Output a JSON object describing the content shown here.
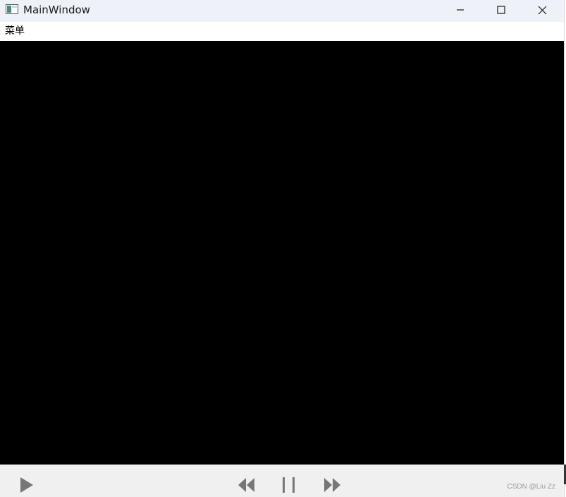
{
  "window": {
    "title": "MainWindow",
    "controls": {
      "minimize_icon": "minimize-icon",
      "maximize_icon": "maximize-icon",
      "close_icon": "close-icon"
    }
  },
  "menubar": {
    "items": [
      {
        "label": "菜单"
      }
    ]
  },
  "video": {
    "background": "#000000"
  },
  "playback_controls": {
    "play_icon": "play-icon",
    "rewind_icon": "rewind-icon",
    "pause_icon": "pause-icon",
    "fast_forward_icon": "fast-forward-icon",
    "icon_color": "#777777"
  },
  "watermark": {
    "text": "CSDN @Liu Zz"
  }
}
